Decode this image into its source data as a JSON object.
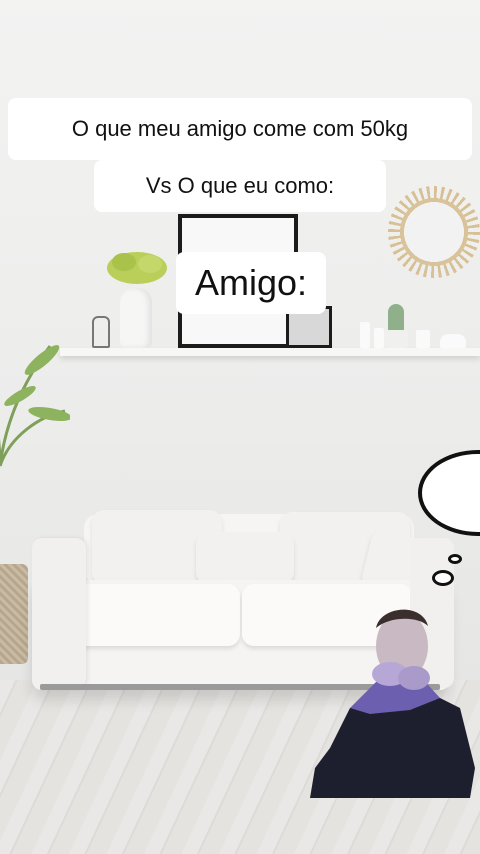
{
  "captions": {
    "line1": "O que meu amigo come com 50kg",
    "line2": "Vs O que eu como:",
    "line3": "Amigo:"
  },
  "icons": {
    "thought_bubble": "thought-bubble-icon",
    "person": "person-cutout"
  },
  "colors": {
    "caption_bg": "#ffffff",
    "caption_text": "#111111",
    "wall": "#ececeb",
    "sofa": "#f5f4f2"
  }
}
